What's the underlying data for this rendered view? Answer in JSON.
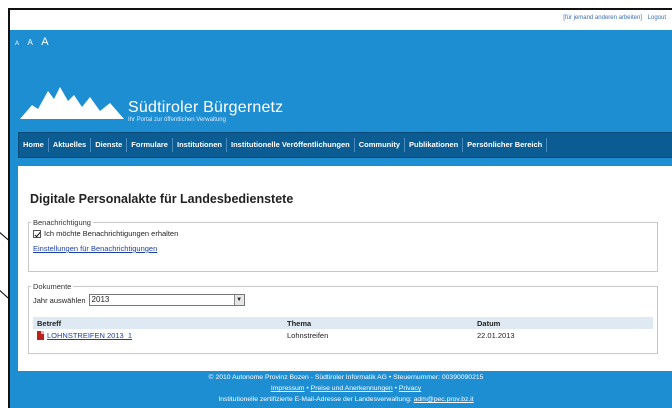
{
  "topbar": {
    "links": [
      "[für jemand anderen arbeiten]",
      "Logout"
    ]
  },
  "font_sizer": {
    "small": "A",
    "medium": "A",
    "large": "A"
  },
  "brand": {
    "title": "Südtiroler Bürgernetz",
    "subtitle": "Ihr Portal zur öffentlichen Verwaltung"
  },
  "nav": [
    "Home",
    "Aktuelles",
    "Dienste",
    "Formulare",
    "Institutionen",
    "Institutionelle Veröffentlichungen",
    "Community",
    "Publikationen",
    "Persönlicher Bereich"
  ],
  "page": {
    "title": "Digitale Personalakte für Landesbedienstete"
  },
  "notifications": {
    "legend": "Benachrichtigung",
    "checkbox_label": "Ich möchte Benachrichtigungen erhalten",
    "checked": true,
    "settings_link": "Einstellungen für Benachrichtigungen"
  },
  "documents": {
    "legend": "Dokumente",
    "year_label": "Jahr auswählen",
    "year_value": "2013",
    "columns": [
      "Betreff",
      "Thema",
      "Datum"
    ],
    "rows": [
      {
        "subject": "LOHNSTREIFEN 2013_1",
        "topic": "Lohnstreifen",
        "date": "22.01.2013"
      }
    ]
  },
  "footer": {
    "line1": "© 2010 Autonome Provinz Bozen - Südtiroler Informatik AG • Steuernummer: 00390090215",
    "links": [
      "Impressum",
      "Preise und Anerkennungen",
      "Privacy"
    ],
    "sep": "•",
    "line3_prefix": "Institutionelle zertifizierte E-Mail-Adresse der Landesverwaltung: ",
    "email": "adm@pec.prov.bz.it"
  },
  "colors": {
    "page_bg": "#1e8ed3",
    "nav_bg": "#0c5c94",
    "table_header": "#dfe9f4",
    "link": "#1a3fa8"
  }
}
